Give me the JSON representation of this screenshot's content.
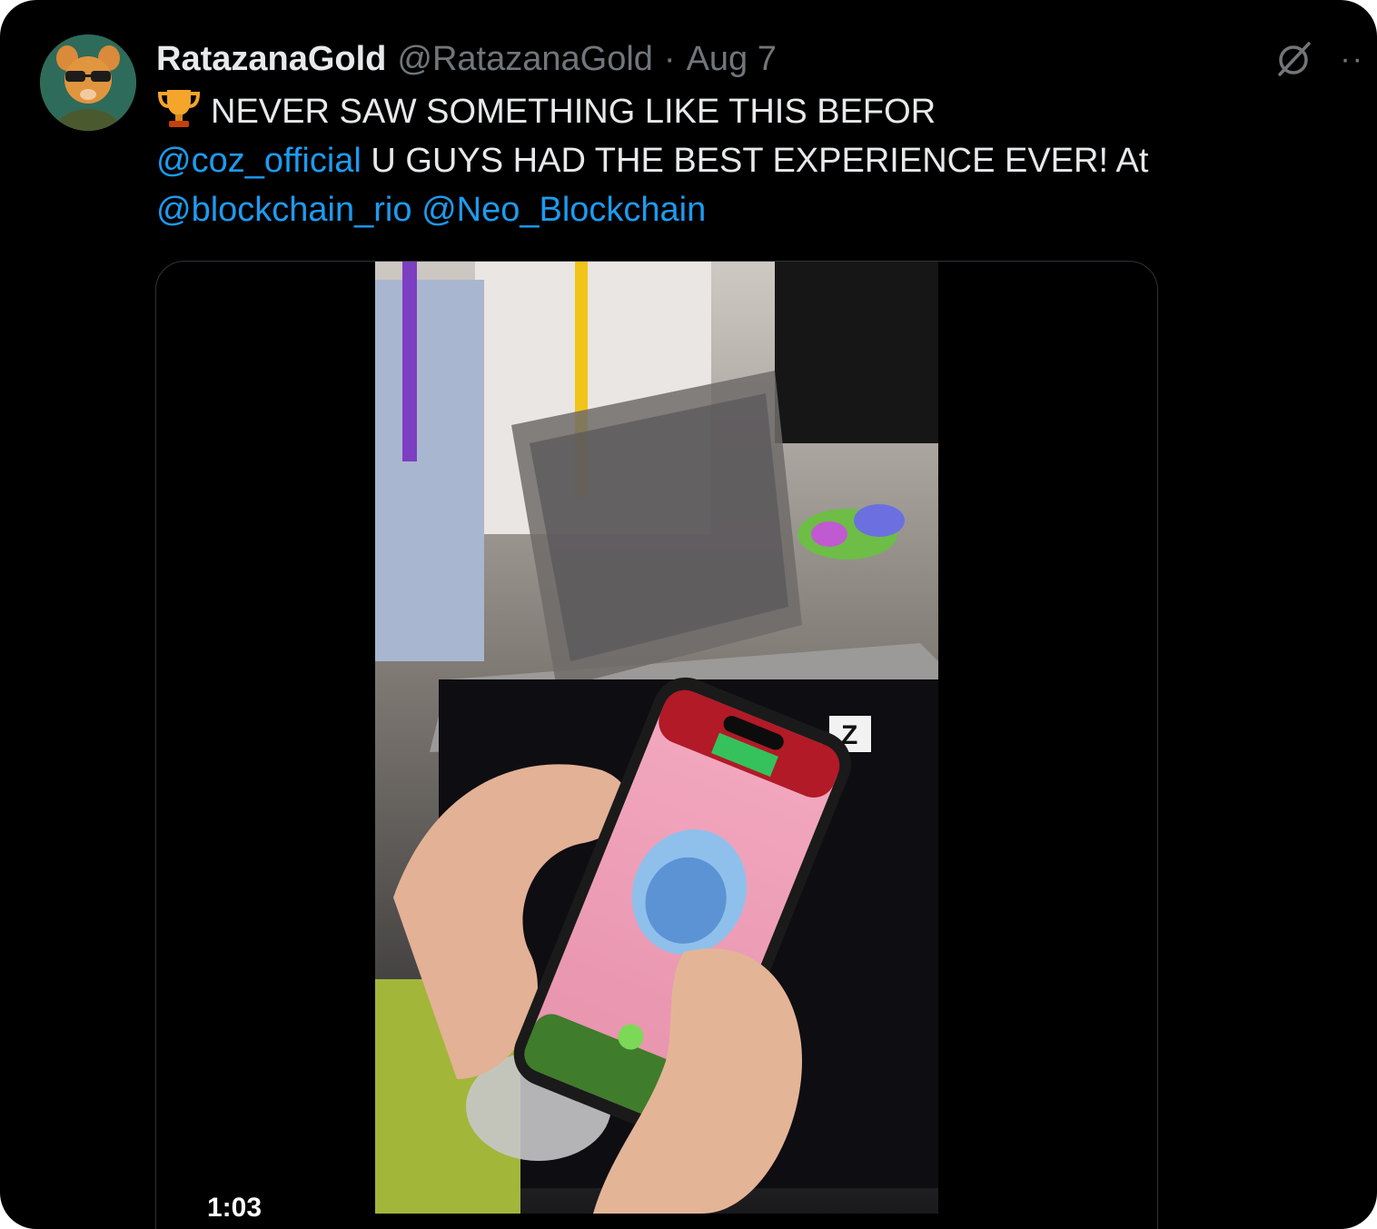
{
  "tweet": {
    "display_name": "RatazanaGold",
    "handle": "@RatazanaGold",
    "separator": "·",
    "date": "Aug 7",
    "text": {
      "line1": "NEVER SAW SOMETHING LIKE THIS BEFOR",
      "line2_mention": "@coz_official",
      "line2_text": " U GUYS HAD THE BEST EXPERIENCE EVER! At",
      "line3_mention1": "@blockchain_rio",
      "line3_space": " ",
      "line3_mention2": "@Neo_Blockchain"
    },
    "more_label": "··"
  },
  "media": {
    "duration": "1:03",
    "sign_letter": "Z"
  },
  "colors": {
    "background": "#000000",
    "primary_text": "#e7e9ea",
    "secondary_text": "#71767b",
    "link": "#1d9bf0"
  },
  "icons": {
    "avatar": "rat-avatar-icon",
    "emoji": "trophy-icon",
    "grok": "grok-slash-icon",
    "more": "more-dots-icon"
  }
}
